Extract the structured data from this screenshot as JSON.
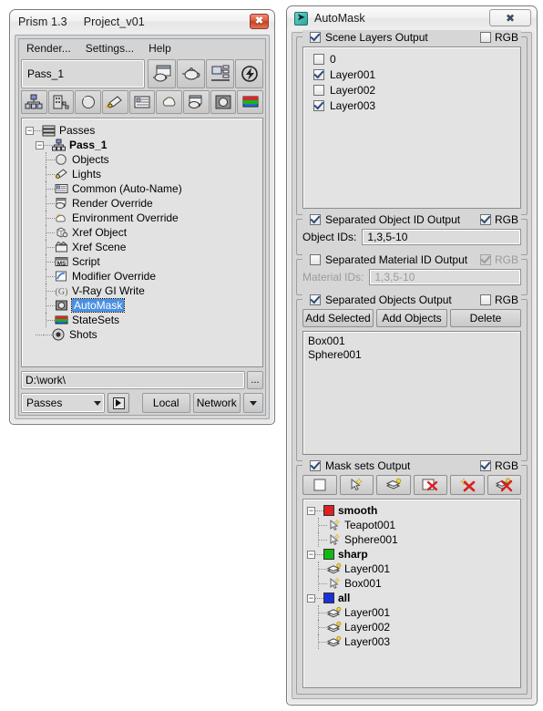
{
  "prism": {
    "title_app": "Prism 1.3",
    "title_project": "Project_v01",
    "close_label": "✖",
    "menu": [
      "Render...",
      "Settings...",
      "Help"
    ],
    "pass_field_value": "Pass_1",
    "toolbar_top_icons": [
      "render-preview-icon",
      "teapot-icon",
      "network-render-icon",
      "flash-icon"
    ],
    "toolbar_row2_icons": [
      "pass-node-icon",
      "batch-icon",
      "objects-icon",
      "lights-icon",
      "common-icon",
      "environment-icon",
      "render-override-icon",
      "automask-icon",
      "statesets-icon"
    ],
    "tree": {
      "root_label": "Passes",
      "pass_label": "Pass_1",
      "children": [
        {
          "label": "Objects",
          "icon": "objects-icon"
        },
        {
          "label": "Lights",
          "icon": "lights-icon"
        },
        {
          "label": "Common (Auto-Name)",
          "icon": "common-icon"
        },
        {
          "label": "Render Override",
          "icon": "render-override-icon"
        },
        {
          "label": "Environment Override",
          "icon": "environment-icon"
        },
        {
          "label": "Xref Object",
          "icon": "xref-object-icon"
        },
        {
          "label": "Xref Scene",
          "icon": "xref-scene-icon"
        },
        {
          "label": "Script",
          "icon": "script-icon"
        },
        {
          "label": "Modifier Override",
          "icon": "modifier-icon"
        },
        {
          "label": "V-Ray GI Write",
          "icon": "vray-gi-icon"
        },
        {
          "label": "AutoMask",
          "icon": "automask-icon",
          "selected": true
        },
        {
          "label": "StateSets",
          "icon": "statesets-icon"
        }
      ],
      "shots_label": "Shots"
    },
    "path_value": "D:\\work\\",
    "browse_label": "...",
    "combo_value": "Passes",
    "local_label": "Local",
    "network_label": "Network"
  },
  "automask": {
    "title": "AutoMask",
    "close_label": "✖",
    "scene_layers": {
      "title": "Scene Layers Output",
      "enabled": true,
      "rgb_label": "RGB",
      "rgb_checked": false,
      "layers": [
        {
          "label": "0",
          "checked": false
        },
        {
          "label": "Layer001",
          "checked": true
        },
        {
          "label": "Layer002",
          "checked": false
        },
        {
          "label": "Layer003",
          "checked": true
        }
      ]
    },
    "object_id": {
      "title": "Separated Object ID Output",
      "enabled": true,
      "rgb_label": "RGB",
      "rgb_checked": true,
      "field_label": "Object IDs:",
      "field_value": "1,3,5-10"
    },
    "material_id": {
      "title": "Separated Material ID Output",
      "enabled": false,
      "rgb_label": "RGB",
      "rgb_checked": true,
      "field_label": "Material IDs:",
      "field_value": "1,3,5-10"
    },
    "objects_output": {
      "title": "Separated Objects Output",
      "enabled": true,
      "rgb_label": "RGB",
      "rgb_checked": false,
      "buttons": [
        "Add Selected",
        "Add Objects",
        "Delete"
      ],
      "items": [
        "Box001",
        "Sphere001"
      ]
    },
    "mask_sets": {
      "title": "Mask sets Output",
      "enabled": true,
      "rgb_label": "RGB",
      "rgb_checked": true,
      "toolbar_icons": [
        "new-mask-set-icon",
        "add-object-icon",
        "add-layer-icon",
        "delete-mask-set-icon",
        "delete-object-icon",
        "delete-layer-icon"
      ],
      "sets": [
        {
          "name": "smooth",
          "color": "#e02020",
          "items": [
            {
              "label": "Teapot001",
              "icon": "object-icon"
            },
            {
              "label": "Sphere001",
              "icon": "object-icon"
            }
          ]
        },
        {
          "name": "sharp",
          "color": "#12b812",
          "items": [
            {
              "label": "Layer001",
              "icon": "layer-icon"
            },
            {
              "label": "Box001",
              "icon": "object-icon"
            }
          ]
        },
        {
          "name": "all",
          "color": "#1a31d8",
          "items": [
            {
              "label": "Layer001",
              "icon": "layer-icon"
            },
            {
              "label": "Layer002",
              "icon": "layer-icon"
            },
            {
              "label": "Layer003",
              "icon": "layer-icon"
            }
          ]
        }
      ]
    }
  }
}
